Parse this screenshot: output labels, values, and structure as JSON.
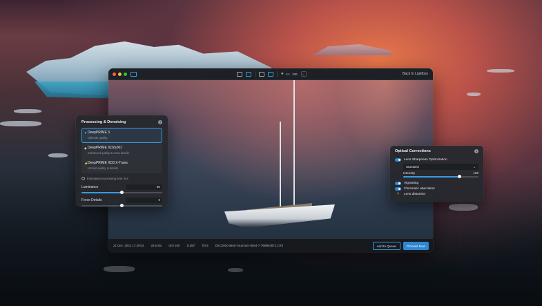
{
  "window": {
    "zoom_label": "1:1",
    "zoom_value": "100",
    "back_link": "Back to Lightbox"
  },
  "status": {
    "date": "21 Dec. 2022 17:29:03",
    "size": "25.6 Mo",
    "iso": "ISO 100",
    "shutter": "1/160\"",
    "aperture": "f/3.8",
    "file": "DSC0000-diest-l-summer-8844-7-7989B4972.CR3",
    "add_queue": "Add to Queue",
    "process_now": "Process Now"
  },
  "processing": {
    "title": "Processing & Denoising",
    "help": "?",
    "options": [
      {
        "name": "DeepPRIME 3",
        "sub": "Ultimate quality",
        "mark": "✦"
      },
      {
        "name": "DeepPRIME XD2s/XD",
        "sub": "Enhanced quality & extra details",
        "mark": "◆"
      },
      {
        "name": "DeepPRIME XD3 X-Trans",
        "sub": "Utmost quality & details",
        "mark": "⚡"
      }
    ],
    "estimate": "Estimated processing time 24s",
    "luminance_label": "Luminance",
    "luminance_value": "50",
    "luminance_level": 0.5,
    "force_label": "Force Details",
    "force_value": "0",
    "force_level": 0.5
  },
  "optical": {
    "title": "Optical Corrections",
    "help": "?",
    "lens_sharpness": "Lens Sharpness Optimization",
    "select_value": "Standard",
    "intensity_label": "Intensity",
    "intensity_value": "100",
    "intensity_level": 0.75,
    "vignetting": "Vignetting",
    "chromatic": "Chromatic aberration",
    "lens_distortion": "Lens distortion",
    "plus": "+"
  },
  "colors": {
    "accent": "#3a9be0",
    "traffic_red": "#fe5f57",
    "traffic_yellow": "#febc2e",
    "traffic_green": "#28c840"
  }
}
